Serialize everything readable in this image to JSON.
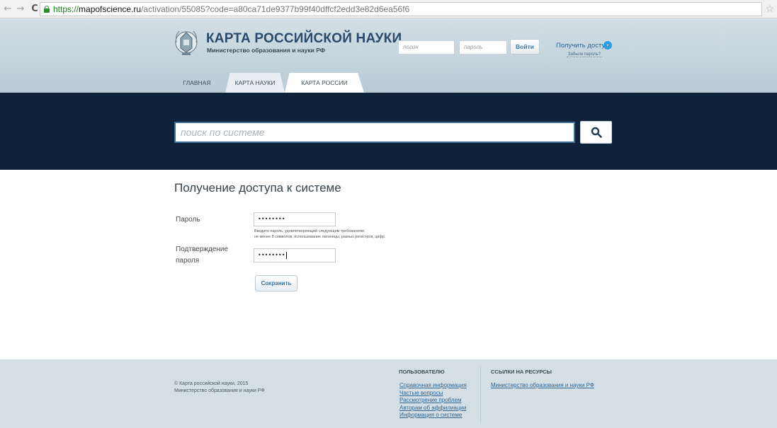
{
  "browser": {
    "url_proto": "https://",
    "url_host": "mapofscience.ru",
    "url_path": "/activation/55085?code=a80ca71de9377b99f40dffcf2edd3e82d6ea56f6"
  },
  "header": {
    "title": "КАРТА РОССИЙСКОЙ НАУКИ",
    "subtitle": "Министерство образования и науки РФ",
    "login_placeholder": "логин",
    "password_placeholder": "пароль",
    "login_button": "Войти",
    "access_link": "Получить доступ",
    "forgot_link": "Забыли пароль?",
    "tabs": [
      "ГЛАВНАЯ",
      "КАРТА НАУКИ",
      "КАРТА РОССИИ"
    ]
  },
  "search": {
    "placeholder": "поиск по системе"
  },
  "form": {
    "title": "Получение доступа к системе",
    "password_label": "Пароль",
    "password_value": "••••••••",
    "hint_line1": "Введите пароль, удовлетворяющий следующим требованиям:",
    "hint_line2": "не менее 8 символов, использование латиницы, разных регистров, цифр.",
    "confirm_label_1": "Подтверждение",
    "confirm_label_2": "пароля",
    "confirm_value": "••••••••",
    "save_button": "Сохранить"
  },
  "footer": {
    "copyright_1": "© Карта российской науки, 2015",
    "copyright_2": "Министерство образования и науки РФ",
    "users_heading": "ПОЛЬЗОВАТЕЛЮ",
    "users_links": [
      "Справочная информация",
      "Частые вопросы",
      "Рассмотрение проблем",
      "Авторам об аффилиации",
      "Информация о системе"
    ],
    "resources_heading": "ССЫЛКИ НА РЕСУРСЫ",
    "resources_links": [
      "Министерство образования и науки РФ"
    ]
  },
  "colors": {
    "header_bg": "#c4d4de",
    "search_band": "#0e2239",
    "link": "#2f6693",
    "footer_bg": "#d4dee5"
  }
}
